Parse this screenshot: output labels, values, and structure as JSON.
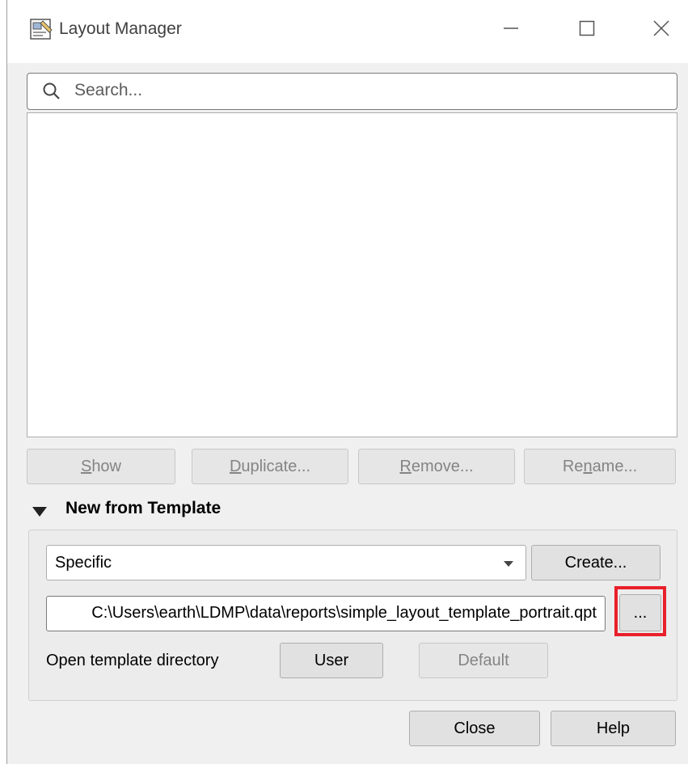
{
  "window": {
    "title": "Layout Manager",
    "icon": "layout-manager-icon",
    "controls": {
      "minimize": "minimize-icon",
      "maximize": "maximize-icon",
      "close": "close-icon"
    }
  },
  "search": {
    "placeholder": "Search..."
  },
  "layouts": [],
  "actions": {
    "show": {
      "prefix": "",
      "mnemonic": "S",
      "suffix": "how"
    },
    "duplicate": {
      "prefix": "",
      "mnemonic": "D",
      "suffix": "uplicate..."
    },
    "remove": {
      "prefix": "",
      "mnemonic": "R",
      "suffix": "emove..."
    },
    "rename": {
      "prefix": "Re",
      "mnemonic": "n",
      "suffix": "ame..."
    }
  },
  "template_section": {
    "title": "New from Template",
    "expanded": true,
    "template_type": "Specific",
    "create_label": "Create...",
    "path_value": "C:\\Users\\earth\\LDMP\\data\\reports\\simple_layout_template_portrait.qpt",
    "browse_label": "...",
    "open_dir_label": "Open template directory",
    "user_label": "User",
    "default_label": "Default"
  },
  "footer": {
    "close_label": "Close",
    "help_label": "Help"
  },
  "colors": {
    "highlight": "#e8202a",
    "dialog_bg": "#f0f0f0"
  }
}
